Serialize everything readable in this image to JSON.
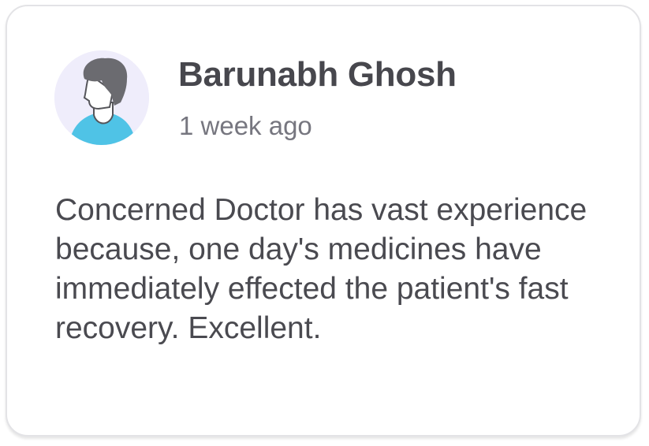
{
  "review": {
    "author_name": "Barunabh Ghosh",
    "posted_time": "1 week ago",
    "text": "Concerned Doctor has vast experience because, one day's medicines have immediately effected the patient's fast recovery. Excellent.",
    "avatar_icon": "user-avatar-icon"
  },
  "colors": {
    "avatar_background": "#efedfb",
    "avatar_shirt": "#4fc3e6",
    "avatar_hair": "#6b6b70",
    "name_text": "#47474d",
    "time_text": "#76767f",
    "body_text": "#4a4a50"
  }
}
